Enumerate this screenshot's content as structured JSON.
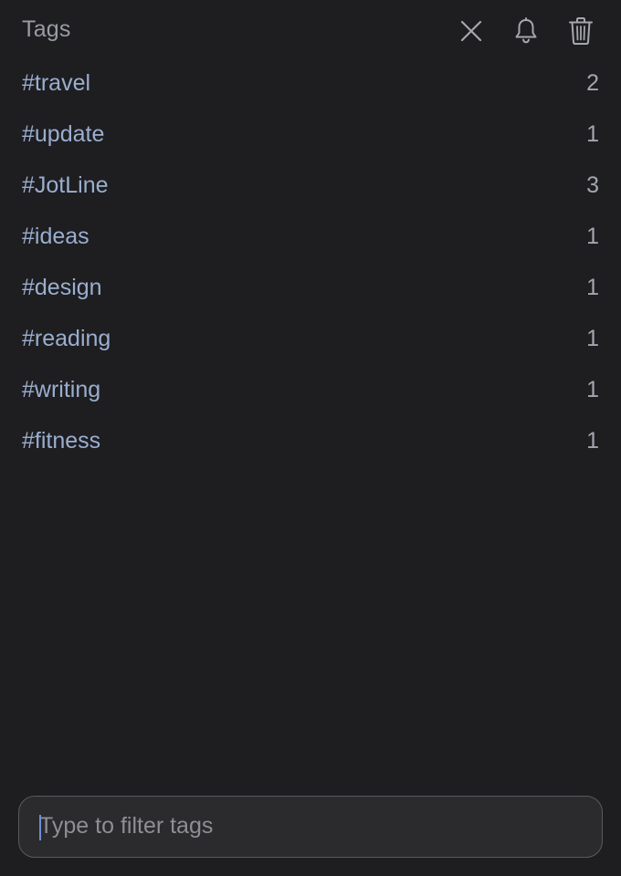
{
  "header": {
    "title": "Tags",
    "close_icon": "close-icon",
    "bell_icon": "bell-icon",
    "trash_icon": "trash-icon"
  },
  "tags": [
    {
      "name": "#travel",
      "count": "2"
    },
    {
      "name": "#update",
      "count": "1"
    },
    {
      "name": "#JotLine",
      "count": "3"
    },
    {
      "name": "#ideas",
      "count": "1"
    },
    {
      "name": "#design",
      "count": "1"
    },
    {
      "name": "#reading",
      "count": "1"
    },
    {
      "name": "#writing",
      "count": "1"
    },
    {
      "name": "#fitness",
      "count": "1"
    }
  ],
  "filter": {
    "value": "",
    "placeholder": "Type to filter tags"
  },
  "colors": {
    "background": "#1e1e20",
    "tag_text": "#9aaed0",
    "count_text": "#a3a6ad",
    "input_bg": "#2b2b2d",
    "caret": "#6d8fd6"
  }
}
